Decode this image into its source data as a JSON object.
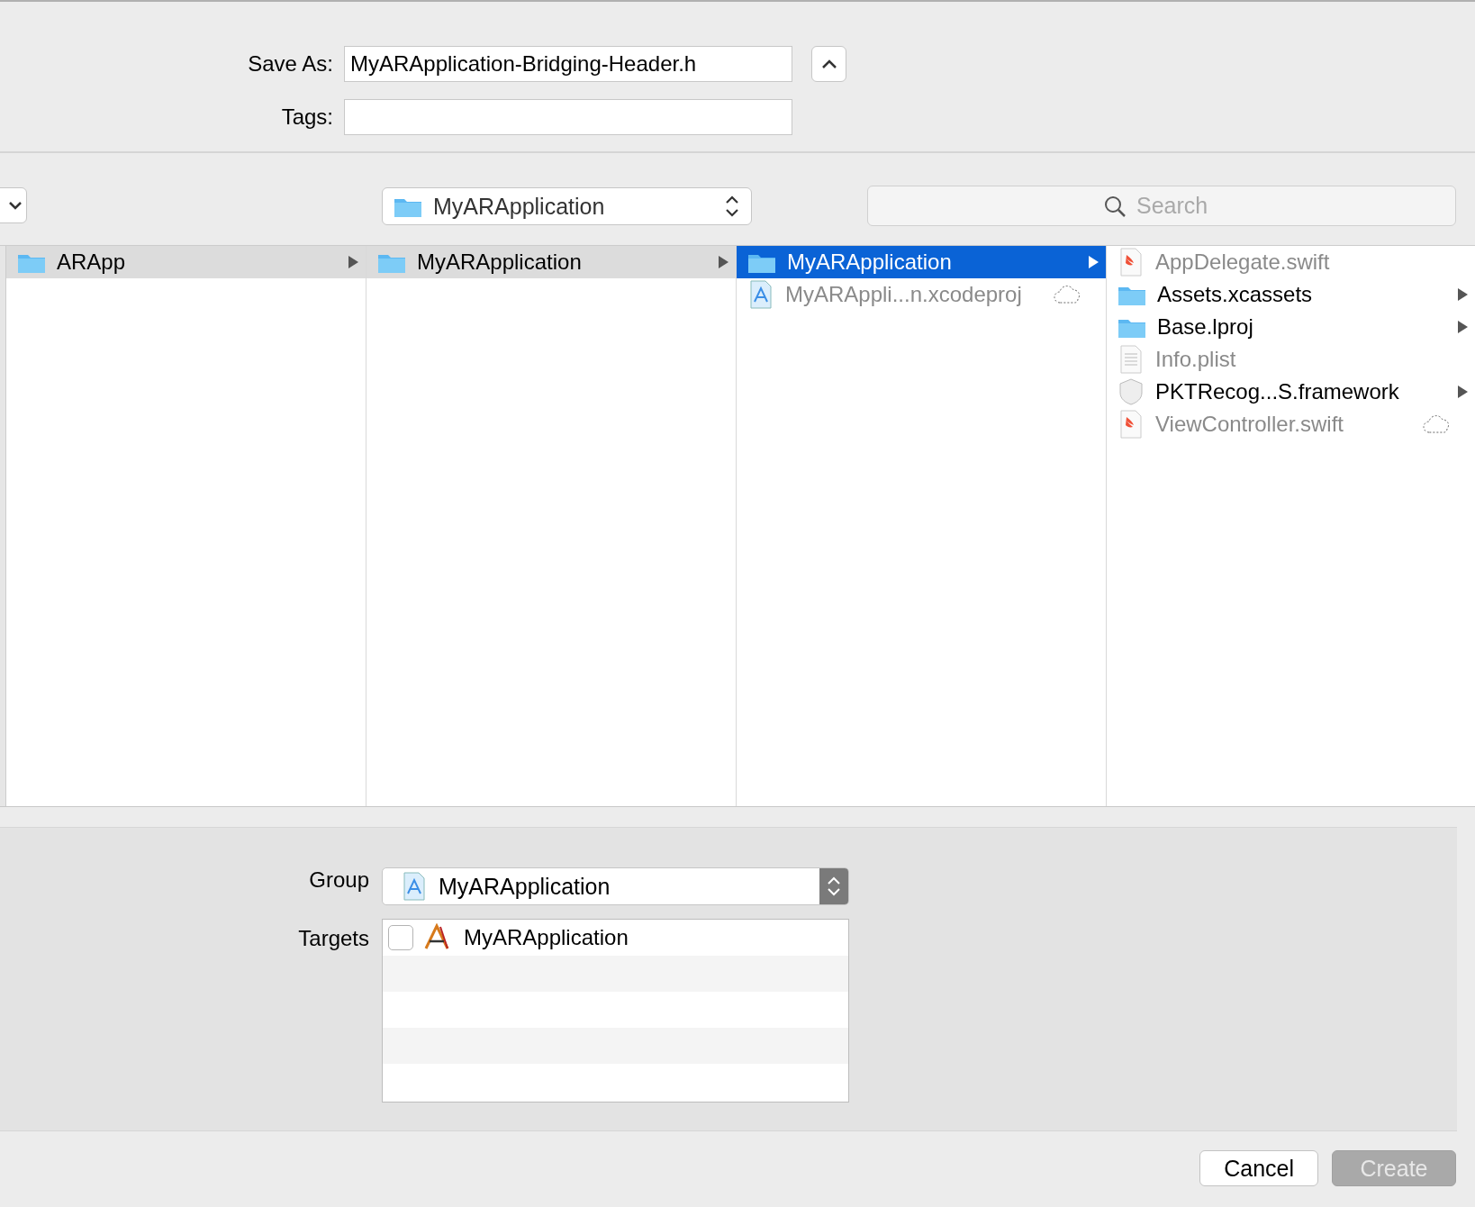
{
  "save_as": {
    "label": "Save As:",
    "value": "MyARApplication-Bridging-Header.h"
  },
  "tags": {
    "label": "Tags:"
  },
  "location": {
    "value": "MyARApplication"
  },
  "search": {
    "placeholder": "Search"
  },
  "columns": [
    {
      "items": [
        {
          "label": "ARApp",
          "kind": "folder",
          "selected": true,
          "expandable": true,
          "dimmed": false,
          "cloud": false
        }
      ]
    },
    {
      "items": [
        {
          "label": "MyARApplication",
          "kind": "folder",
          "selected": true,
          "expandable": true,
          "dimmed": false,
          "cloud": false
        }
      ]
    },
    {
      "items": [
        {
          "label": "MyARApplication",
          "kind": "folder",
          "selected": true,
          "expandable": true,
          "dimmed": false,
          "cloud": false
        },
        {
          "label": "MyARAppli...n.xcodeproj",
          "kind": "project",
          "selected": false,
          "expandable": false,
          "dimmed": true,
          "cloud": true
        }
      ]
    },
    {
      "items": [
        {
          "label": "AppDelegate.swift",
          "kind": "swift",
          "selected": false,
          "expandable": false,
          "dimmed": true,
          "cloud": false
        },
        {
          "label": "Assets.xcassets",
          "kind": "folder",
          "selected": false,
          "expandable": true,
          "dimmed": false,
          "cloud": false
        },
        {
          "label": "Base.lproj",
          "kind": "folder",
          "selected": false,
          "expandable": true,
          "dimmed": false,
          "cloud": false
        },
        {
          "label": "Info.plist",
          "kind": "plist",
          "selected": false,
          "expandable": false,
          "dimmed": true,
          "cloud": false
        },
        {
          "label": "PKTRecog...S.framework",
          "kind": "framework",
          "selected": false,
          "expandable": true,
          "dimmed": false,
          "cloud": false
        },
        {
          "label": "ViewController.swift",
          "kind": "swift",
          "selected": false,
          "expandable": false,
          "dimmed": true,
          "cloud": true
        }
      ]
    }
  ],
  "group": {
    "label": "Group",
    "value": "MyARApplication"
  },
  "targets": {
    "label": "Targets",
    "items": [
      {
        "label": "MyARApplication",
        "checked": false
      }
    ]
  },
  "buttons": [
    {
      "label": "Cancel",
      "kind": "cancel",
      "disabled": false
    },
    {
      "label": "Create",
      "kind": "default",
      "disabled": true
    }
  ]
}
